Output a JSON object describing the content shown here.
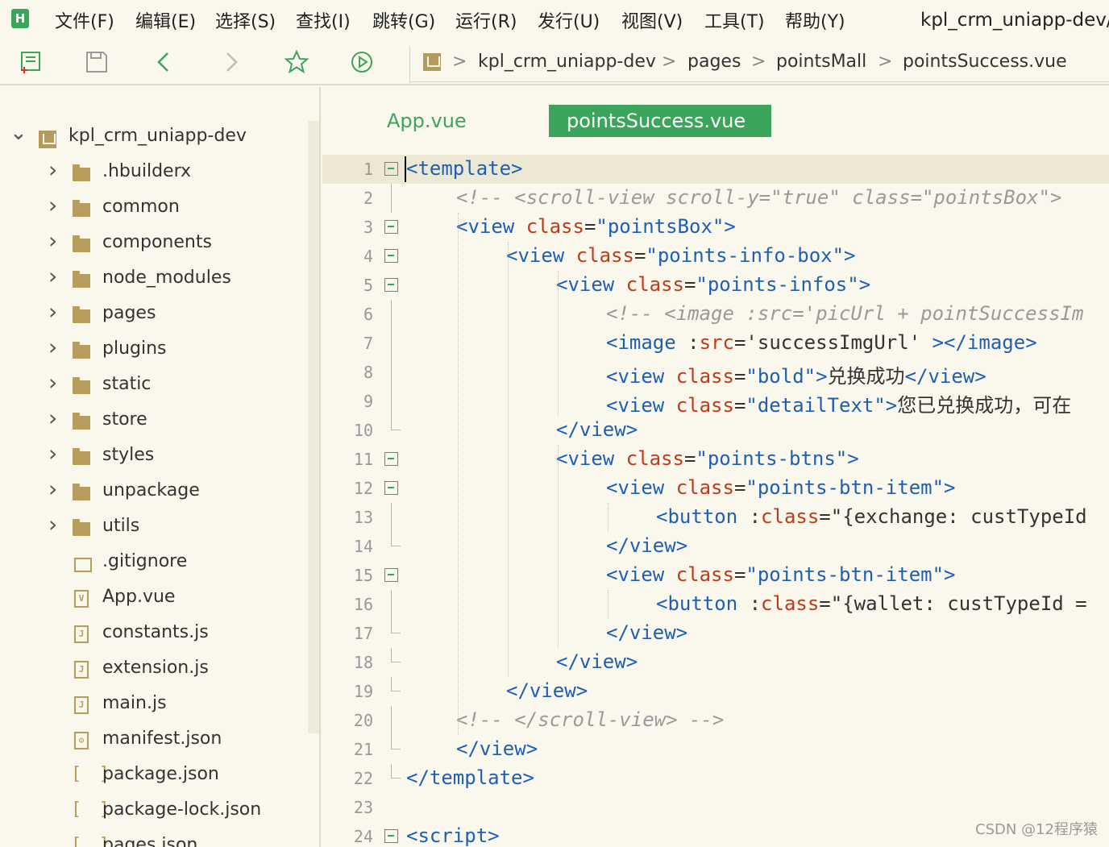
{
  "app": {
    "window_title": "kpl_crm_uniapp-dev/p",
    "logo_text": "H"
  },
  "menu": [
    {
      "label": "文件(F)"
    },
    {
      "label": "编辑(E)"
    },
    {
      "label": "选择(S)"
    },
    {
      "label": "查找(I)"
    },
    {
      "label": "跳转(G)"
    },
    {
      "label": "运行(R)"
    },
    {
      "label": "发行(U)"
    },
    {
      "label": "视图(V)"
    },
    {
      "label": "工具(T)"
    },
    {
      "label": "帮助(Y)"
    }
  ],
  "toolbar": {
    "icons": [
      "new-file-icon",
      "save-icon",
      "back-icon",
      "forward-icon",
      "favorite-star-icon",
      "run-icon"
    ]
  },
  "breadcrumb": {
    "items": [
      "kpl_crm_uniapp-dev",
      "pages",
      "pointsMall",
      "pointsSuccess.vue"
    ],
    "separator": ">"
  },
  "project_tree": {
    "root": "kpl_crm_uniapp-dev",
    "folders": [
      "hbuilderx",
      "common",
      "components",
      "node_modules",
      "pages",
      "plugins",
      "static",
      "store",
      "styles",
      "unpackage",
      "utils"
    ],
    "files": [
      {
        "name": ".gitignore",
        "icon": "file-icon"
      },
      {
        "name": "App.vue",
        "icon": "vue-file-icon"
      },
      {
        "name": "constants.js",
        "icon": "js-file-icon"
      },
      {
        "name": "extension.js",
        "icon": "js-file-icon"
      },
      {
        "name": "main.js",
        "icon": "js-file-icon"
      },
      {
        "name": "manifest.json",
        "icon": "settings-file-icon"
      },
      {
        "name": "package.json",
        "icon": "json-file-icon"
      },
      {
        "name": "package-lock.json",
        "icon": "json-file-icon"
      },
      {
        "name": "pages.json",
        "icon": "json-file-icon"
      }
    ]
  },
  "editor": {
    "tabs": [
      {
        "label": "App.vue",
        "active": false
      },
      {
        "label": "pointsSuccess.vue",
        "active": true
      }
    ],
    "lines": [
      {
        "n": "1",
        "tokens": [
          [
            "tg",
            "<template>"
          ]
        ]
      },
      {
        "n": "2",
        "tokens": [
          [
            "cm",
            "<!-- <scroll-view scroll-y=\"true\" class=\"pointsBox\">"
          ]
        ]
      },
      {
        "n": "3",
        "tokens": [
          [
            "tg",
            "<view "
          ],
          [
            "at",
            "class"
          ],
          [
            "st",
            "="
          ],
          [
            "tg",
            "\"pointsBox\">"
          ]
        ]
      },
      {
        "n": "4",
        "tokens": [
          [
            "tg",
            "<view "
          ],
          [
            "at",
            "class"
          ],
          [
            "st",
            "="
          ],
          [
            "tg",
            "\"points-info-box\">"
          ]
        ]
      },
      {
        "n": "5",
        "tokens": [
          [
            "tg",
            "<view "
          ],
          [
            "at",
            "class"
          ],
          [
            "st",
            "="
          ],
          [
            "tg",
            "\"points-infos\">"
          ]
        ]
      },
      {
        "n": "6",
        "tokens": [
          [
            "cm",
            "<!-- <image :src='picUrl + pointSuccessIm"
          ]
        ]
      },
      {
        "n": "7",
        "tokens": [
          [
            "tg",
            "<image "
          ],
          [
            "tx",
            ":"
          ],
          [
            "at",
            "src"
          ],
          [
            "st",
            "='successImgUrl' "
          ],
          [
            "tg",
            "></image>"
          ]
        ]
      },
      {
        "n": "8",
        "tokens": [
          [
            "tg",
            "<view "
          ],
          [
            "at",
            "class"
          ],
          [
            "st",
            "="
          ],
          [
            "tg",
            "\"bold\">"
          ],
          [
            "tx",
            "兑换成功"
          ],
          [
            "tg",
            "</view>"
          ]
        ]
      },
      {
        "n": "9",
        "tokens": [
          [
            "tg",
            "<view "
          ],
          [
            "at",
            "class"
          ],
          [
            "st",
            "="
          ],
          [
            "tg",
            "\"detailText\">"
          ],
          [
            "tx",
            "您已兑换成功，可在"
          ]
        ]
      },
      {
        "n": "10",
        "tokens": [
          [
            "tg",
            "</view>"
          ]
        ]
      },
      {
        "n": "11",
        "tokens": [
          [
            "tg",
            "<view "
          ],
          [
            "at",
            "class"
          ],
          [
            "st",
            "="
          ],
          [
            "tg",
            "\"points-btns\">"
          ]
        ]
      },
      {
        "n": "12",
        "tokens": [
          [
            "tg",
            "<view "
          ],
          [
            "at",
            "class"
          ],
          [
            "st",
            "="
          ],
          [
            "tg",
            "\"points-btn-item\">"
          ]
        ]
      },
      {
        "n": "13",
        "tokens": [
          [
            "tg",
            "<button "
          ],
          [
            "tx",
            ":"
          ],
          [
            "at",
            "class"
          ],
          [
            "st",
            "=\"{exchange: custTypeId"
          ]
        ]
      },
      {
        "n": "14",
        "tokens": [
          [
            "tg",
            "</view>"
          ]
        ]
      },
      {
        "n": "15",
        "tokens": [
          [
            "tg",
            "<view "
          ],
          [
            "at",
            "class"
          ],
          [
            "st",
            "="
          ],
          [
            "tg",
            "\"points-btn-item\">"
          ]
        ]
      },
      {
        "n": "16",
        "tokens": [
          [
            "tg",
            "<button "
          ],
          [
            "tx",
            ":"
          ],
          [
            "at",
            "class"
          ],
          [
            "st",
            "=\"{wallet: custTypeId ="
          ]
        ]
      },
      {
        "n": "17",
        "tokens": [
          [
            "tg",
            "</view>"
          ]
        ]
      },
      {
        "n": "18",
        "tokens": [
          [
            "tg",
            "</view>"
          ]
        ]
      },
      {
        "n": "19",
        "tokens": [
          [
            "tg",
            "</view>"
          ]
        ]
      },
      {
        "n": "20",
        "tokens": [
          [
            "cm",
            "<!-- </scroll-view> -->"
          ]
        ]
      },
      {
        "n": "21",
        "tokens": [
          [
            "tg",
            "</view>"
          ]
        ]
      },
      {
        "n": "22",
        "tokens": [
          [
            "tg",
            "</template>"
          ]
        ]
      },
      {
        "n": "23",
        "tokens": []
      },
      {
        "n": "24",
        "tokens": [
          [
            "tg",
            "<script>"
          ]
        ]
      }
    ]
  },
  "watermark": "CSDN @12程序猿",
  "colors": {
    "accent": "#3BA55C",
    "background": "#FAF7EC",
    "tag": "#1F5FB0",
    "attribute": "#C03A1A",
    "comment": "#9A9A9A"
  }
}
